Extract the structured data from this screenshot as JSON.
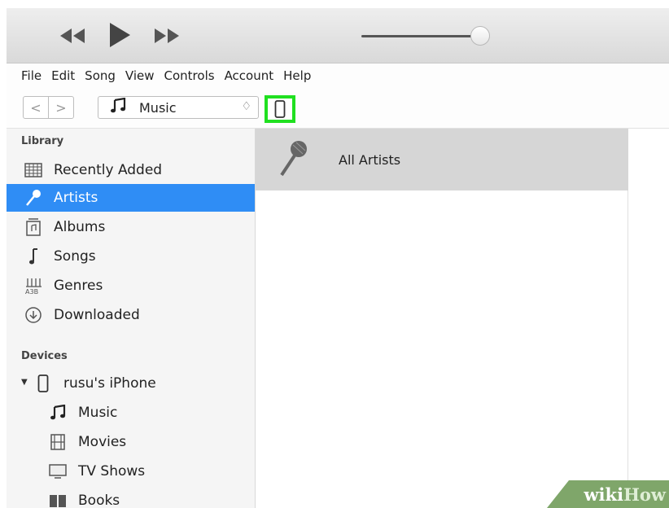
{
  "menu": [
    "File",
    "Edit",
    "Song",
    "View",
    "Controls",
    "Account",
    "Help"
  ],
  "toolbar": {
    "back": "<",
    "forward": ">",
    "media_kind": "Music",
    "stepper": "♢"
  },
  "library": {
    "heading": "Library",
    "items": [
      {
        "label": "Recently Added",
        "icon": "calendar-grid-icon"
      },
      {
        "label": "Artists",
        "icon": "microphone-icon",
        "selected": true
      },
      {
        "label": "Albums",
        "icon": "album-icon"
      },
      {
        "label": "Songs",
        "icon": "music-note-icon"
      },
      {
        "label": "Genres",
        "icon": "genres-icon"
      },
      {
        "label": "Downloaded",
        "icon": "download-circle-icon"
      }
    ]
  },
  "devices": {
    "heading": "Devices",
    "device_name": "rusu's iPhone",
    "items": [
      {
        "label": "Music",
        "icon": "music-note-icon"
      },
      {
        "label": "Movies",
        "icon": "film-icon"
      },
      {
        "label": "TV Shows",
        "icon": "tv-icon"
      },
      {
        "label": "Books",
        "icon": "book-icon"
      }
    ]
  },
  "main": {
    "row_label": "All Artists"
  },
  "watermark": {
    "part1": "wiki",
    "part2": "How"
  },
  "colors": {
    "selection": "#2f8df5",
    "highlight": "#20e020"
  }
}
